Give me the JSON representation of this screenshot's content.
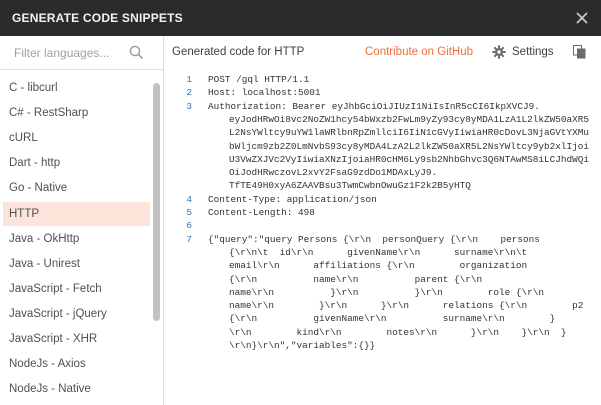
{
  "dialog": {
    "title": "GENERATE CODE SNIPPETS"
  },
  "sidebar": {
    "search_placeholder": "Filter languages...",
    "items": [
      {
        "label": "C - libcurl",
        "active": false
      },
      {
        "label": "C# - RestSharp",
        "active": false
      },
      {
        "label": "cURL",
        "active": false
      },
      {
        "label": "Dart - http",
        "active": false
      },
      {
        "label": "Go - Native",
        "active": false
      },
      {
        "label": "HTTP",
        "active": true
      },
      {
        "label": "Java - OkHttp",
        "active": false
      },
      {
        "label": "Java - Unirest",
        "active": false
      },
      {
        "label": "JavaScript - Fetch",
        "active": false
      },
      {
        "label": "JavaScript - jQuery",
        "active": false
      },
      {
        "label": "JavaScript - XHR",
        "active": false
      },
      {
        "label": "NodeJs - Axios",
        "active": false
      },
      {
        "label": "NodeJs - Native",
        "active": false
      }
    ]
  },
  "header": {
    "generated_label": "Generated code for HTTP",
    "github_link": "Contribute on GitHub",
    "settings_label": "Settings"
  },
  "code": {
    "lines": [
      {
        "num": "1",
        "text": "POST /gql HTTP/1.1",
        "cont": []
      },
      {
        "num": "2",
        "text": "Host: localhost:5001",
        "cont": []
      },
      {
        "num": "3",
        "text": "Authorization: Bearer eyJhbGciOiJIUzI1NiIsInR5cCI6IkpXVCJ9.",
        "cont": [
          "eyJodHRwOi8vc2NoZW1hcy54bWxzb2FwLm9yZy93cy8yMDA1LzA1L2lkZW50aXR5",
          "L2NsYWltcy9uYW1laWRlbnRpZmllciI6IiN1cGVyIiwiaHR0cDovL3NjaGVtYXMu",
          "bWljcm9zb2Z0LmNvbS93cy8yMDA4LzA2L2lkZW50aXR5L2NsYWltcy9yb2xlIjoi",
          "U3VwZXJVc2VyIiwiaXNzIjoiaHR0cHM6Ly9sb2NhbGhvc3Q6NTAwMS8iLCJhdWQi",
          "OiJodHRwczovL2xvY2FsaG9zdDo1MDAxLyJ9.",
          "TfTE49H0xyA6ZAAVBsu3TwmCwbnOwuGz1F2k2B5yHTQ"
        ]
      },
      {
        "num": "4",
        "text": "Content-Type: application/json",
        "cont": []
      },
      {
        "num": "5",
        "text": "Content-Length: 498",
        "cont": []
      },
      {
        "num": "6",
        "text": "",
        "cont": []
      },
      {
        "num": "7",
        "text": "{\"query\":\"query Persons {\\r\\n  personQuery {\\r\\n    persons",
        "cont": [
          "{\\r\\n\\t  id\\r\\n      givenName\\r\\n      surname\\r\\n\\t",
          "email\\r\\n      affiliations {\\r\\n        organization",
          "{\\r\\n          name\\r\\n          parent {\\r\\n",
          "name\\r\\n          }\\r\\n          }\\r\\n        role {\\r\\n",
          "name\\r\\n        }\\r\\n      }\\r\\n      relations {\\r\\n        p2",
          "{\\r\\n          givenName\\r\\n          surname\\r\\n        }",
          "\\r\\n        kind\\r\\n        notes\\r\\n      }\\r\\n    }\\r\\n  }",
          "\\r\\n}\\r\\n\",\"variables\":{}}"
        ]
      }
    ]
  },
  "colors": {
    "titlebar_bg": "#2b2b2b",
    "accent": "#f26b3a",
    "active_item_bg": "#fde4db",
    "line_number": "#3a6fb0"
  }
}
